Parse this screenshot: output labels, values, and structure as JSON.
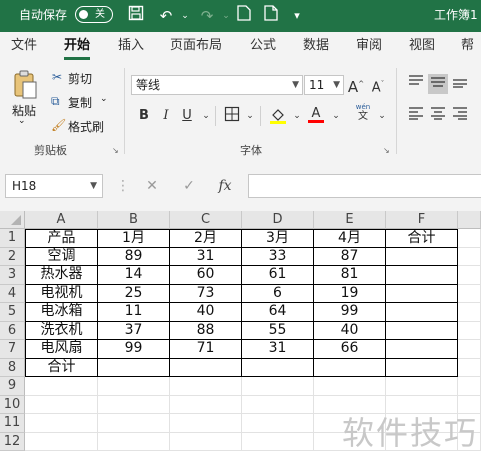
{
  "titlebar": {
    "autosave_label": "自动保存",
    "autosave_state": "关",
    "doc_title": "工作簿1"
  },
  "menu": {
    "tabs": [
      "文件",
      "开始",
      "插入",
      "页面布局",
      "公式",
      "数据",
      "审阅",
      "视图",
      "帮助"
    ],
    "active": "开始"
  },
  "ribbon": {
    "clipboard": {
      "paste": "粘贴",
      "cut": "剪切",
      "copy": "复制",
      "format_painter": "格式刷",
      "group": "剪贴板"
    },
    "font": {
      "name": "等线",
      "size": "11",
      "bold": "B",
      "italic": "I",
      "underline": "U",
      "phonetic_top": "wén",
      "phonetic_bottom": "文",
      "group": "字体"
    }
  },
  "formula_bar": {
    "name_box": "H18",
    "fx": "fx",
    "value": ""
  },
  "sheet": {
    "columns": [
      "A",
      "B",
      "C",
      "D",
      "E",
      "F"
    ],
    "rows": [
      "1",
      "2",
      "3",
      "4",
      "5",
      "6",
      "7",
      "8",
      "9",
      "10",
      "11",
      "12"
    ],
    "cells": [
      [
        "产品",
        "1月",
        "2月",
        "3月",
        "4月",
        "合计"
      ],
      [
        "空调",
        "89",
        "31",
        "33",
        "87",
        ""
      ],
      [
        "热水器",
        "14",
        "60",
        "61",
        "81",
        ""
      ],
      [
        "电视机",
        "25",
        "73",
        "6",
        "19",
        ""
      ],
      [
        "电冰箱",
        "11",
        "40",
        "64",
        "99",
        ""
      ],
      [
        "洗衣机",
        "37",
        "88",
        "55",
        "40",
        ""
      ],
      [
        "电风扇",
        "99",
        "71",
        "31",
        "66",
        ""
      ],
      [
        "合计",
        "",
        "",
        "",
        "",
        ""
      ]
    ]
  },
  "watermark": "软件技巧"
}
